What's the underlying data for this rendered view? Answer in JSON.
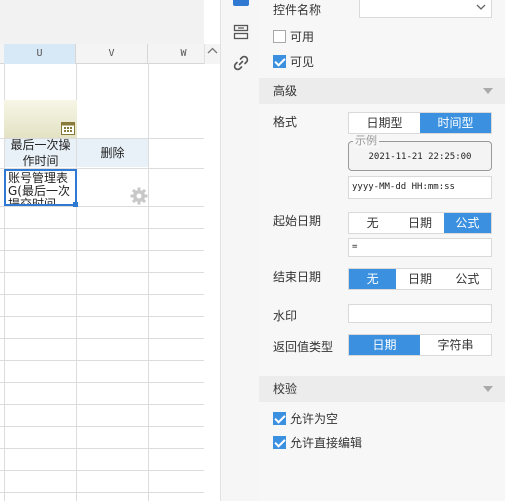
{
  "sheet": {
    "columns": [
      "U",
      "V",
      "W"
    ],
    "header_cells": [
      "最后一次操作时间",
      "删除"
    ],
    "selected_cell_text": "账号管理表G(最后一次提交时间"
  },
  "panel": {
    "widget_name": {
      "label": "控件名称",
      "value": ""
    },
    "enabled": {
      "label": "可用",
      "checked": false
    },
    "visible": {
      "label": "可见",
      "checked": true
    },
    "advanced_section": "高级",
    "format": {
      "label": "格式",
      "options": [
        "日期型",
        "时间型"
      ],
      "selected": "时间型",
      "example_legend": "示例",
      "example_value": "2021-11-21 22:25:00",
      "pattern": "yyyy-MM-dd HH:mm:ss"
    },
    "start_date": {
      "label": "起始日期",
      "options": [
        "无",
        "日期",
        "公式"
      ],
      "selected": "公式",
      "formula": "="
    },
    "end_date": {
      "label": "结束日期",
      "options": [
        "无",
        "日期",
        "公式"
      ],
      "selected": "无"
    },
    "watermark": {
      "label": "水印",
      "value": ""
    },
    "return_type": {
      "label": "返回值类型",
      "options": [
        "日期",
        "字符串"
      ],
      "selected": "日期"
    },
    "validation_section": "校验",
    "allow_empty": {
      "label": "允许为空",
      "checked": true
    },
    "allow_direct_edit": {
      "label": "允许直接编辑",
      "checked": true
    }
  },
  "colors": {
    "accent": "#3b91e0",
    "selection": "#2f79d3"
  }
}
